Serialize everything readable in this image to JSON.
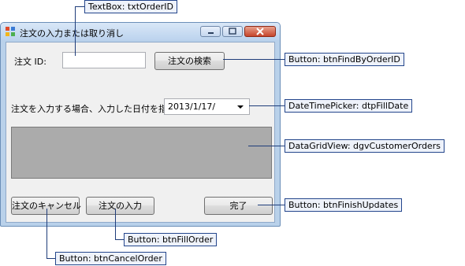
{
  "window": {
    "title": "注文の入力または取り消し",
    "icon": "windows-forms-app-icon"
  },
  "form": {
    "order_id_label": "注文 ID:",
    "order_id_value": "",
    "find_button": "注文の検索",
    "date_label": "注文を入力する場合、入力した日付を指定",
    "date_value": "2013/1/17/",
    "cancel_button": "注文のキャンセル",
    "fill_button": "注文の入力",
    "finish_button": "完了"
  },
  "callouts": {
    "txt_order_id": "TextBox: txtOrderID",
    "btn_find": "Button: btnFindByOrderID",
    "dtp_fill_date": "DateTimePicker: dtpFillDate",
    "dgv_orders": "DataGridView: dgvCustomerOrders",
    "btn_finish": "Button: btnFinishUpdates",
    "btn_fill": "Button: btnFillOrder",
    "btn_cancel": "Button: btnCancelOrder"
  }
}
